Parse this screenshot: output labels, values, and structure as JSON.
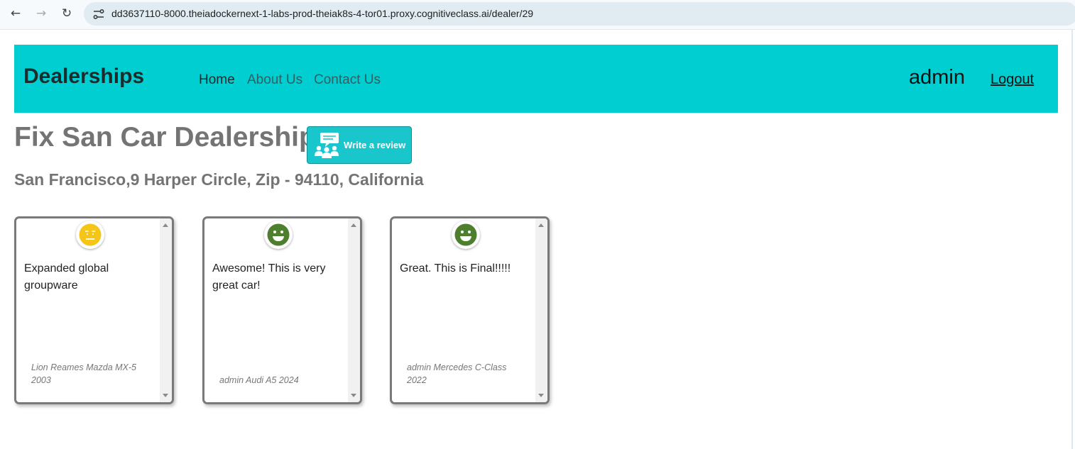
{
  "browser": {
    "url": "dd3637110-8000.theiadockernext-1-labs-prod-theiak8s-4-tor01.proxy.cognitiveclass.ai/dealer/29"
  },
  "navbar": {
    "brand": "Dealerships",
    "links": [
      {
        "label": "Home",
        "active": true
      },
      {
        "label": "About Us",
        "active": false
      },
      {
        "label": "Contact Us",
        "active": false
      }
    ],
    "username": "admin",
    "logout_label": "Logout",
    "background_color": "#00ced1"
  },
  "dealer": {
    "name": "Fix San Car Dealership",
    "address": "San Francisco,9 Harper Circle, Zip - 94110, California",
    "write_review_label": "Write a review"
  },
  "reviews": [
    {
      "sentiment": "neutral",
      "icon": "neutral-face-icon",
      "text": "Expanded global groupware",
      "meta": "Lion Reames Mazda MX-5 2003"
    },
    {
      "sentiment": "positive",
      "icon": "smiley-face-icon",
      "text": "Awesome! This is very great car!",
      "meta": "admin Audi A5 2024"
    },
    {
      "sentiment": "positive",
      "icon": "smiley-face-icon",
      "text": "Great. This is Final!!!!!",
      "meta": "admin Mercedes C-Class 2022"
    }
  ],
  "colors": {
    "neutral": "#f5c518",
    "positive": "#4e7f2e",
    "heading_gray": "#747474"
  }
}
